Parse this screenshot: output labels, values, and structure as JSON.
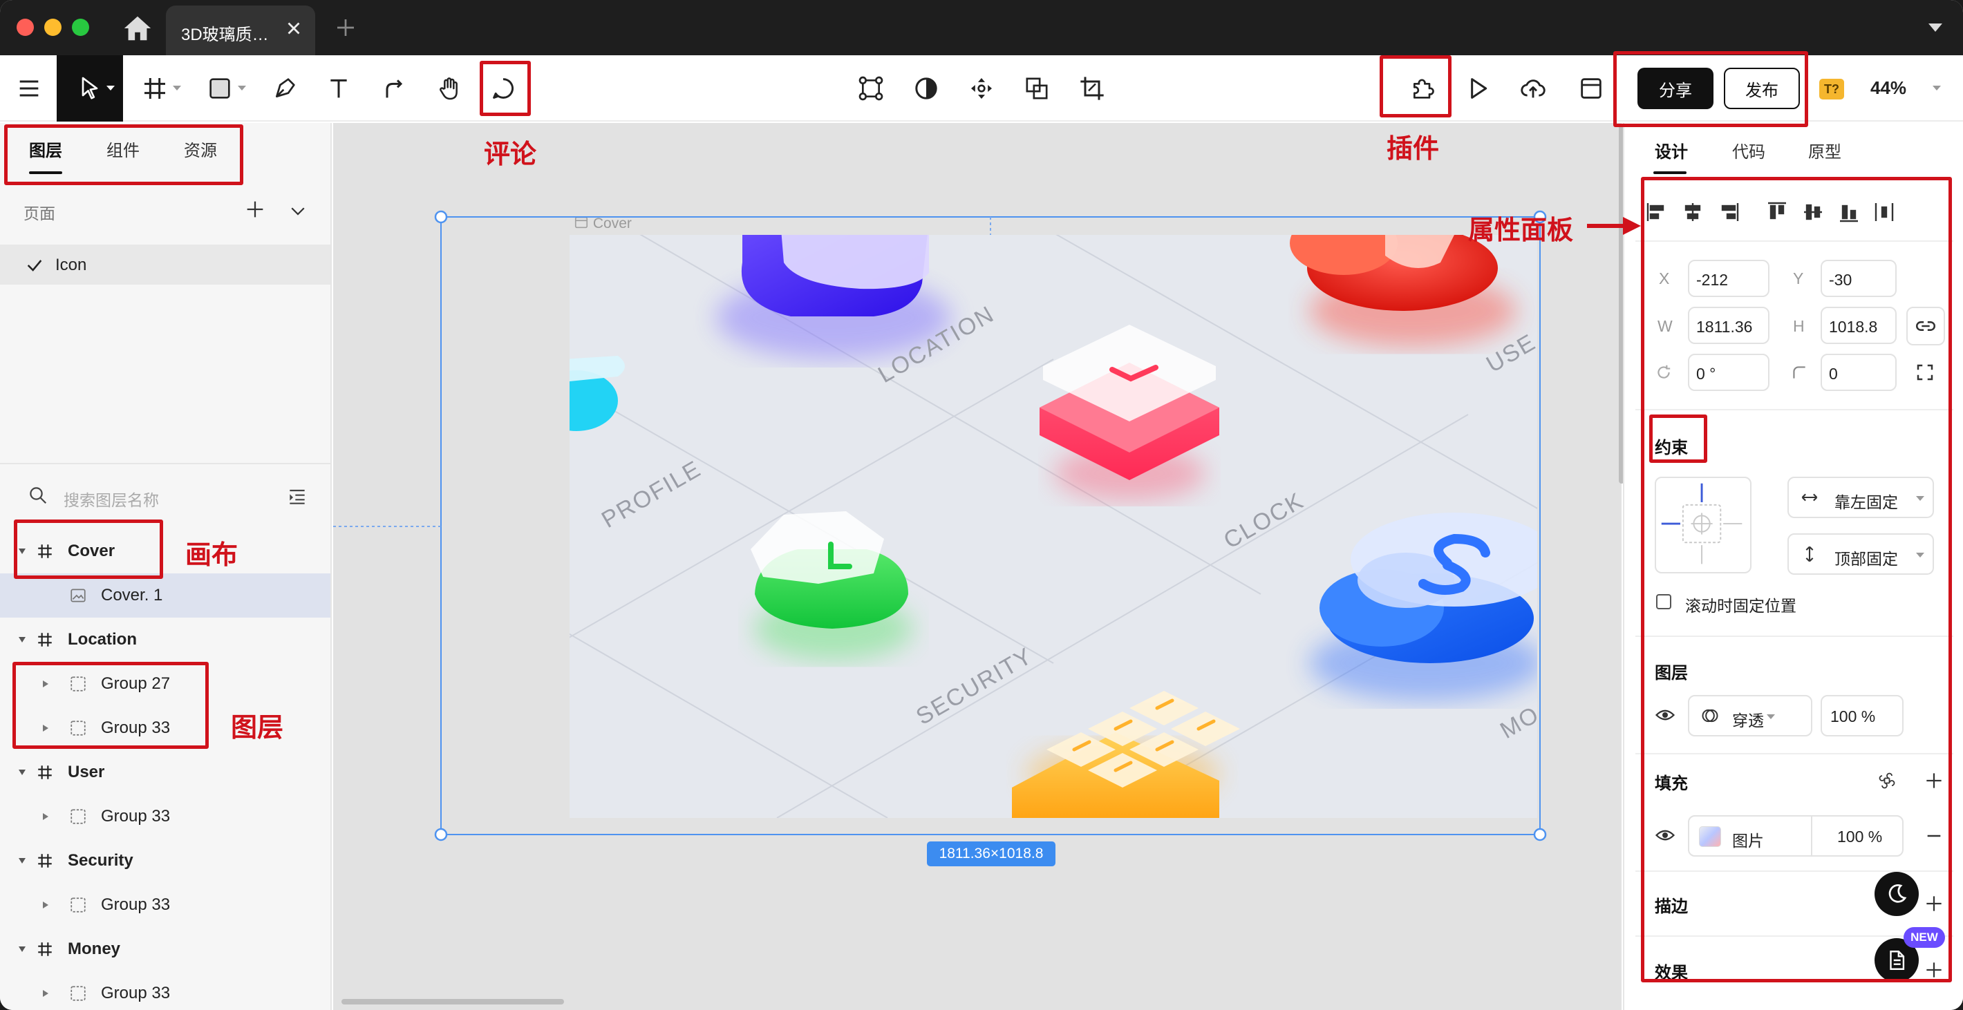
{
  "titlebar": {
    "tab_title": "3D玻璃质…",
    "traffic_lights": {
      "close": "#fe5f57",
      "minimize": "#febc2e",
      "zoom": "#28c840"
    }
  },
  "toolbar": {
    "share_label": "分享",
    "publish_label": "发布",
    "badge_label": "T?",
    "zoom_level": "44%"
  },
  "left_panel": {
    "tabs": [
      "图层",
      "组件",
      "资源"
    ],
    "pages_title": "页面",
    "current_page": "Icon",
    "search_placeholder": "搜索图层名称",
    "layers": [
      {
        "name": "Cover",
        "type": "frame"
      },
      {
        "name": "Cover. 1",
        "type": "image"
      },
      {
        "name": "Location",
        "type": "frame"
      },
      {
        "name": "Group 27",
        "type": "group"
      },
      {
        "name": "Group 33",
        "type": "group"
      },
      {
        "name": "User",
        "type": "frame"
      },
      {
        "name": "Group 33",
        "type": "group"
      },
      {
        "name": "Security",
        "type": "frame"
      },
      {
        "name": "Group 33",
        "type": "group"
      },
      {
        "name": "Money",
        "type": "frame"
      },
      {
        "name": "Group 33",
        "type": "group"
      }
    ]
  },
  "canvas": {
    "artboard_name": "Cover",
    "size_label": "1811.36×1018.8",
    "artwork_words": [
      "LOCATION",
      "PROFILE",
      "CLOCK",
      "SECURITY",
      "USE",
      "MO"
    ]
  },
  "right_panel": {
    "tabs": [
      "设计",
      "代码",
      "原型"
    ],
    "x_label": "X",
    "x_value": "-212",
    "y_label": "Y",
    "y_value": "-30",
    "w_label": "W",
    "w_value": "1811.36",
    "h_label": "H",
    "h_value": "1018.8",
    "rotation_value": "0 °",
    "radius_value": "0",
    "constraints_title": "约束",
    "constraint_h": "靠左固定",
    "constraint_v": "顶部固定",
    "fix_on_scroll": "滚动时固定位置",
    "layer_title": "图层",
    "blend_mode": "穿透",
    "layer_opacity": "100 %",
    "fill_title": "填充",
    "fill_type": "图片",
    "fill_opacity": "100 %",
    "stroke_title": "描边",
    "effects_title": "效果",
    "new_badge": "NEW"
  },
  "annotations": {
    "comment": "评论",
    "plugin": "插件",
    "properties": "属性面板",
    "canvas": "画布",
    "layers": "图层"
  }
}
